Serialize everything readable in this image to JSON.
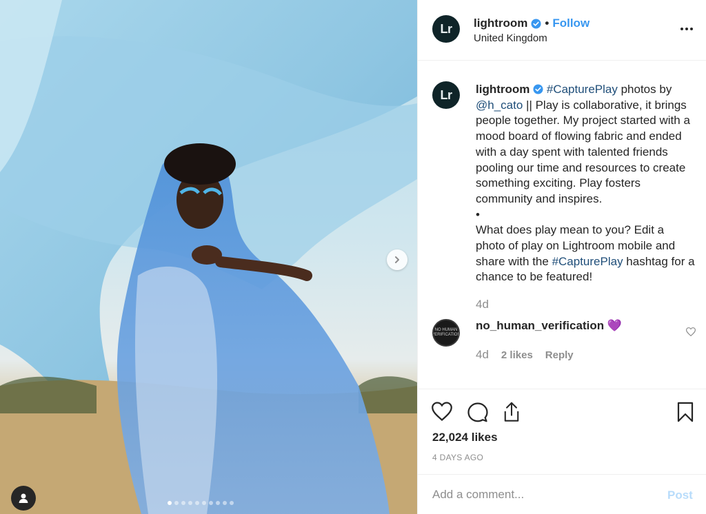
{
  "post": {
    "photo_alt": "Woman wrapped in flowing blue fabric in a field",
    "carousel": {
      "count": 10,
      "active_index": 0
    }
  },
  "header": {
    "avatar_text": "Lr",
    "username": "lightroom",
    "separator": "•",
    "follow_label": "Follow",
    "location": "United Kingdom",
    "more_icon": "more-horizontal-icon"
  },
  "caption": {
    "avatar_text": "Lr",
    "username": "lightroom",
    "hashtag1": "#CapturePlay",
    "text1": " photos by ",
    "mention": "@h_cato",
    "text2": " || Play is collaborative, it brings people together. My project started with a mood board of flowing fabric and ended with a day spent with talented friends pooling our time and resources to create something exciting. Play fosters community and inspires.",
    "bullet": "•",
    "text3": "What does play mean to you? Edit a photo of play on Lightroom mobile and share with the ",
    "hashtag2": "#CapturePlay",
    "text4": " hashtag for a chance to be featured!",
    "age": "4d"
  },
  "comment": {
    "avatar_text": "NO HUMAN VERIFICATION",
    "username": "no_human_verification",
    "emoji": "💜",
    "age": "4d",
    "likes": "2 likes",
    "reply_label": "Reply"
  },
  "actions": {
    "likes": "22,024 likes",
    "timestamp": "4 DAYS AGO"
  },
  "add_comment": {
    "placeholder": "Add a comment...",
    "post_label": "Post"
  },
  "colors": {
    "link_blue": "#3897f0",
    "hashtag": "#1f4e79",
    "muted": "#8e8e8e",
    "post_disabled": "#b8dcfb"
  }
}
